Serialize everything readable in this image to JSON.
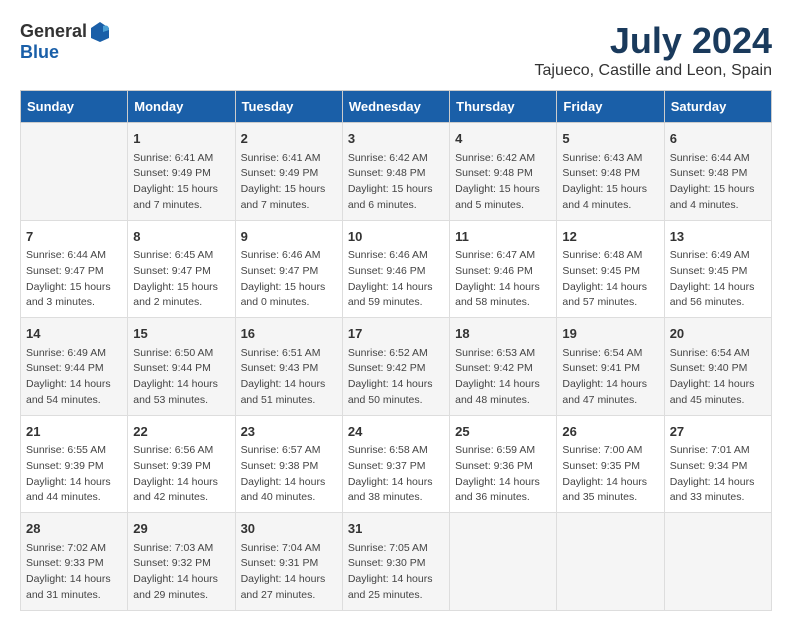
{
  "header": {
    "logo_general": "General",
    "logo_blue": "Blue",
    "title": "July 2024",
    "subtitle": "Tajueco, Castille and Leon, Spain"
  },
  "days_of_week": [
    "Sunday",
    "Monday",
    "Tuesday",
    "Wednesday",
    "Thursday",
    "Friday",
    "Saturday"
  ],
  "weeks": [
    [
      {
        "day": "",
        "info": ""
      },
      {
        "day": "1",
        "info": "Sunrise: 6:41 AM\nSunset: 9:49 PM\nDaylight: 15 hours\nand 7 minutes."
      },
      {
        "day": "2",
        "info": "Sunrise: 6:41 AM\nSunset: 9:49 PM\nDaylight: 15 hours\nand 7 minutes."
      },
      {
        "day": "3",
        "info": "Sunrise: 6:42 AM\nSunset: 9:48 PM\nDaylight: 15 hours\nand 6 minutes."
      },
      {
        "day": "4",
        "info": "Sunrise: 6:42 AM\nSunset: 9:48 PM\nDaylight: 15 hours\nand 5 minutes."
      },
      {
        "day": "5",
        "info": "Sunrise: 6:43 AM\nSunset: 9:48 PM\nDaylight: 15 hours\nand 4 minutes."
      },
      {
        "day": "6",
        "info": "Sunrise: 6:44 AM\nSunset: 9:48 PM\nDaylight: 15 hours\nand 4 minutes."
      }
    ],
    [
      {
        "day": "7",
        "info": "Sunrise: 6:44 AM\nSunset: 9:47 PM\nDaylight: 15 hours\nand 3 minutes."
      },
      {
        "day": "8",
        "info": "Sunrise: 6:45 AM\nSunset: 9:47 PM\nDaylight: 15 hours\nand 2 minutes."
      },
      {
        "day": "9",
        "info": "Sunrise: 6:46 AM\nSunset: 9:47 PM\nDaylight: 15 hours\nand 0 minutes."
      },
      {
        "day": "10",
        "info": "Sunrise: 6:46 AM\nSunset: 9:46 PM\nDaylight: 14 hours\nand 59 minutes."
      },
      {
        "day": "11",
        "info": "Sunrise: 6:47 AM\nSunset: 9:46 PM\nDaylight: 14 hours\nand 58 minutes."
      },
      {
        "day": "12",
        "info": "Sunrise: 6:48 AM\nSunset: 9:45 PM\nDaylight: 14 hours\nand 57 minutes."
      },
      {
        "day": "13",
        "info": "Sunrise: 6:49 AM\nSunset: 9:45 PM\nDaylight: 14 hours\nand 56 minutes."
      }
    ],
    [
      {
        "day": "14",
        "info": "Sunrise: 6:49 AM\nSunset: 9:44 PM\nDaylight: 14 hours\nand 54 minutes."
      },
      {
        "day": "15",
        "info": "Sunrise: 6:50 AM\nSunset: 9:44 PM\nDaylight: 14 hours\nand 53 minutes."
      },
      {
        "day": "16",
        "info": "Sunrise: 6:51 AM\nSunset: 9:43 PM\nDaylight: 14 hours\nand 51 minutes."
      },
      {
        "day": "17",
        "info": "Sunrise: 6:52 AM\nSunset: 9:42 PM\nDaylight: 14 hours\nand 50 minutes."
      },
      {
        "day": "18",
        "info": "Sunrise: 6:53 AM\nSunset: 9:42 PM\nDaylight: 14 hours\nand 48 minutes."
      },
      {
        "day": "19",
        "info": "Sunrise: 6:54 AM\nSunset: 9:41 PM\nDaylight: 14 hours\nand 47 minutes."
      },
      {
        "day": "20",
        "info": "Sunrise: 6:54 AM\nSunset: 9:40 PM\nDaylight: 14 hours\nand 45 minutes."
      }
    ],
    [
      {
        "day": "21",
        "info": "Sunrise: 6:55 AM\nSunset: 9:39 PM\nDaylight: 14 hours\nand 44 minutes."
      },
      {
        "day": "22",
        "info": "Sunrise: 6:56 AM\nSunset: 9:39 PM\nDaylight: 14 hours\nand 42 minutes."
      },
      {
        "day": "23",
        "info": "Sunrise: 6:57 AM\nSunset: 9:38 PM\nDaylight: 14 hours\nand 40 minutes."
      },
      {
        "day": "24",
        "info": "Sunrise: 6:58 AM\nSunset: 9:37 PM\nDaylight: 14 hours\nand 38 minutes."
      },
      {
        "day": "25",
        "info": "Sunrise: 6:59 AM\nSunset: 9:36 PM\nDaylight: 14 hours\nand 36 minutes."
      },
      {
        "day": "26",
        "info": "Sunrise: 7:00 AM\nSunset: 9:35 PM\nDaylight: 14 hours\nand 35 minutes."
      },
      {
        "day": "27",
        "info": "Sunrise: 7:01 AM\nSunset: 9:34 PM\nDaylight: 14 hours\nand 33 minutes."
      }
    ],
    [
      {
        "day": "28",
        "info": "Sunrise: 7:02 AM\nSunset: 9:33 PM\nDaylight: 14 hours\nand 31 minutes."
      },
      {
        "day": "29",
        "info": "Sunrise: 7:03 AM\nSunset: 9:32 PM\nDaylight: 14 hours\nand 29 minutes."
      },
      {
        "day": "30",
        "info": "Sunrise: 7:04 AM\nSunset: 9:31 PM\nDaylight: 14 hours\nand 27 minutes."
      },
      {
        "day": "31",
        "info": "Sunrise: 7:05 AM\nSunset: 9:30 PM\nDaylight: 14 hours\nand 25 minutes."
      },
      {
        "day": "",
        "info": ""
      },
      {
        "day": "",
        "info": ""
      },
      {
        "day": "",
        "info": ""
      }
    ]
  ]
}
